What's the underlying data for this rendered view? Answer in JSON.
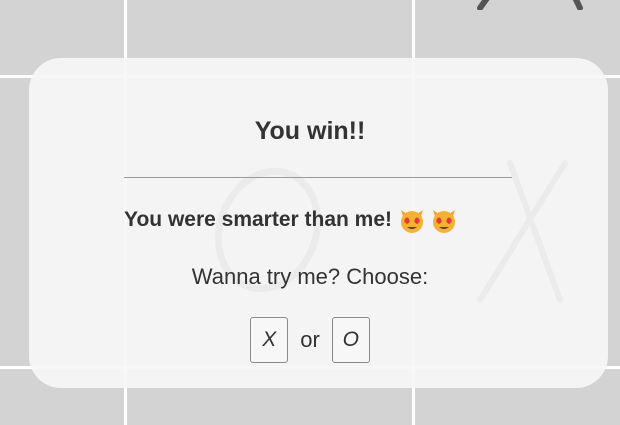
{
  "board": {
    "cells": [
      "",
      "",
      "X",
      "",
      "O",
      "X",
      "",
      "",
      ""
    ]
  },
  "dialog": {
    "title": "You win!!",
    "message": "You were smarter than me!",
    "message_emoji": [
      "heart-eyes-cat-icon",
      "heart-eyes-cat-icon"
    ],
    "prompt": "Wanna try me? Choose:",
    "choice_x": "X",
    "or_label": "or",
    "choice_o": "O"
  },
  "colors": {
    "board_bg": "#d3d3d3",
    "grid_lines": "#ffffff",
    "marks": "#555555",
    "dialog_bg": "#f6f6f6",
    "text": "#333333"
  }
}
